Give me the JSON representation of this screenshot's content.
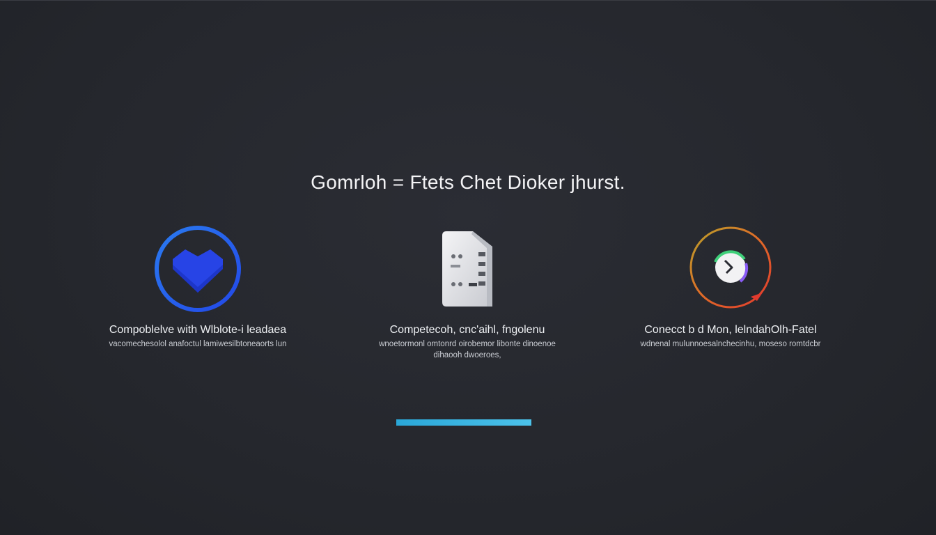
{
  "header": {
    "title": "Gomrloh = Ftets Chet Dioker jhurst."
  },
  "features": [
    {
      "icon": "heart-shield-icon",
      "title": "Compoblelve with Wlblote-i leadaea",
      "desc": [
        "vacomechesolol anafoctul lamiwesilbtoneaorts lun"
      ]
    },
    {
      "icon": "device-icon",
      "title": "Competecoh, cnc'aihl, fngolenu",
      "desc": [
        "wnoetormonl omtonrd oirobemor libonte dinoenoe",
        "dihaooh dwoeroes,"
      ]
    },
    {
      "icon": "sync-clock-icon",
      "title": "Conecct b d Mon, lelndahOlh-Fatel",
      "desc": [
        "wdnenal mulunnoesalnchecinhu, moseso romtdcbr"
      ]
    }
  ],
  "progress": {
    "value": 1.0
  },
  "colors": {
    "background": "#25272d",
    "accent_blue": "#2563eb",
    "progress": "#3bb5e3"
  }
}
